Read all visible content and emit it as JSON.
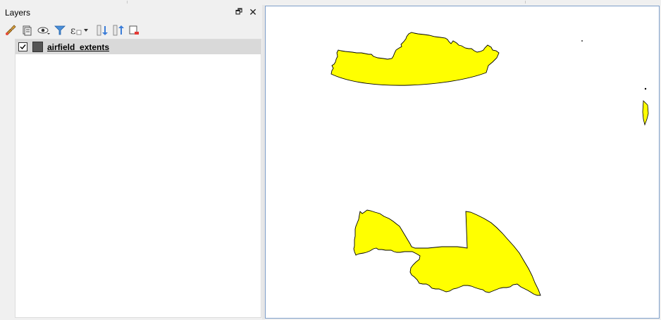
{
  "layers_panel": {
    "title": "Layers",
    "float_icon": "restore-icon",
    "close_icon": "close-icon",
    "toolbar_icons": [
      "style-manager-icon",
      "add-group-icon",
      "visibility-icon",
      "filter-legend-icon",
      "expression-filter-icon",
      "expand-all-icon",
      "collapse-all-icon",
      "remove-layer-icon"
    ],
    "layers": [
      {
        "name": "airfield_extents",
        "checked": true,
        "swatch_color": "#555555"
      }
    ]
  },
  "map": {
    "background": "#ffffff",
    "feature_fill": "#ffff00",
    "feature_stroke": "#000000"
  }
}
